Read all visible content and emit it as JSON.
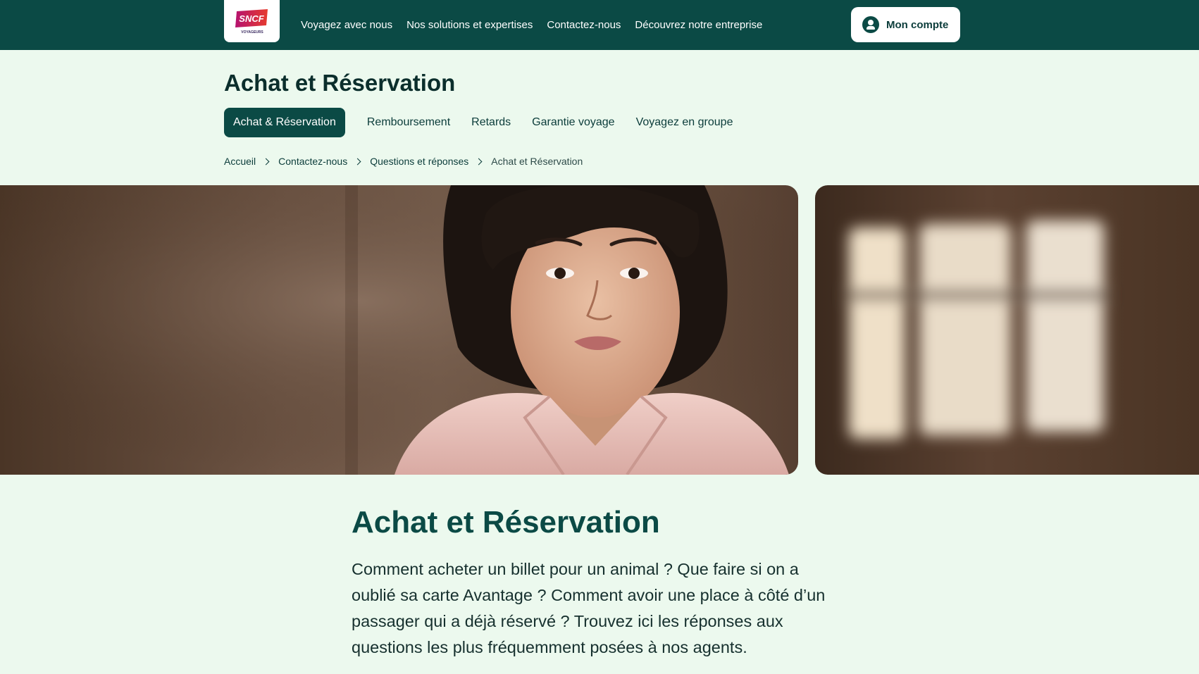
{
  "brand": {
    "logo_text": "SNCF",
    "logo_subtext": "VOYAGEURS",
    "logo_colors": [
      "#b5126f",
      "#e63b2e"
    ]
  },
  "nav": {
    "items": [
      {
        "label": "Voyagez avec nous"
      },
      {
        "label": "Nos solutions et expertises"
      },
      {
        "label": "Contactez-nous"
      },
      {
        "label": "Découvrez notre entreprise"
      }
    ],
    "account_label": "Mon compte"
  },
  "page": {
    "title": "Achat et Réservation"
  },
  "tabs": [
    {
      "label": "Achat & Réservation",
      "active": true
    },
    {
      "label": "Remboursement",
      "active": false
    },
    {
      "label": "Retards",
      "active": false
    },
    {
      "label": "Garantie voyage",
      "active": false
    },
    {
      "label": "Voyagez en groupe",
      "active": false
    }
  ],
  "breadcrumb": [
    {
      "label": "Accueil"
    },
    {
      "label": "Contactez-nous"
    },
    {
      "label": "Questions et réponses"
    },
    {
      "label": "Achat et Réservation"
    }
  ],
  "article": {
    "title": "Achat et Réservation",
    "intro": "Comment acheter un billet pour un animal ? Que faire si on a oublié sa carte Avantage ? Comment avoir une place à côté d’un passager qui a déjà réservé ? Trouvez ici les réponses aux questions les plus fréquemment posées à nos agents."
  },
  "colors": {
    "header_bg": "#0b4a45",
    "page_bg": "#ecf9ee",
    "accent_text": "#0b4a45"
  }
}
